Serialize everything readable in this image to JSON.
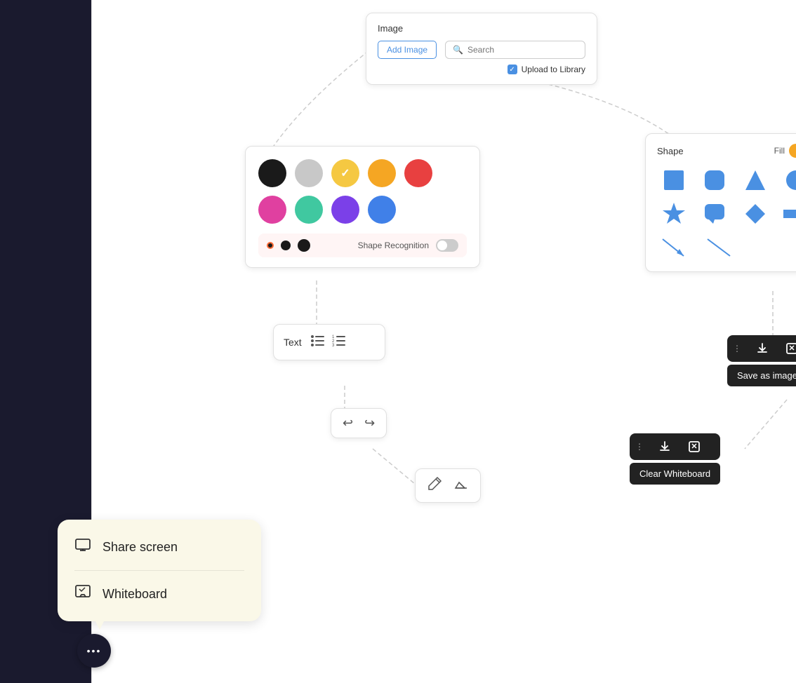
{
  "leftSidebar": {
    "background": "#1a1a2e"
  },
  "imagePanel": {
    "title": "Image",
    "addImageLabel": "Add Image",
    "searchPlaceholder": "Search",
    "uploadLabel": "Upload to Library",
    "uploadChecked": true
  },
  "colorPanel": {
    "colors": [
      {
        "name": "black",
        "hex": "#1a1a1a",
        "selected": false
      },
      {
        "name": "light-gray",
        "hex": "#c8c8c8",
        "selected": false
      },
      {
        "name": "yellow",
        "hex": "#f5c842",
        "selected": true
      },
      {
        "name": "orange",
        "hex": "#f5a623",
        "selected": false
      },
      {
        "name": "red",
        "hex": "#e84040",
        "selected": false
      },
      {
        "name": "pink",
        "hex": "#e040a0",
        "selected": false
      },
      {
        "name": "teal",
        "hex": "#40c8a0",
        "selected": false
      },
      {
        "name": "purple",
        "hex": "#7b40e8",
        "selected": false
      },
      {
        "name": "blue",
        "hex": "#4080e8",
        "selected": false
      }
    ],
    "shapeRecognitionLabel": "Shape Recognition",
    "shapeRecognitionEnabled": false,
    "penSizes": [
      "small",
      "medium",
      "large"
    ]
  },
  "shapePanel": {
    "title": "Shape",
    "fillLabel": "Fill",
    "fillEnabled": true,
    "shapes": [
      "square",
      "rounded-square",
      "triangle",
      "circle",
      "star",
      "chat-bubble",
      "diamond",
      "arrow-right",
      "diagonal-arrow",
      "diagonal-line"
    ]
  },
  "textPanel": {
    "textLabel": "Text",
    "bulletListIcon": "☰",
    "numberedListIcon": "≡"
  },
  "undoPanel": {
    "undoLabel": "↩",
    "redoLabel": "↪"
  },
  "drawPanel": {
    "penLabel": "✏",
    "eraserLabel": "⌫"
  },
  "saveToolbar": {
    "dotsLabel": "•••",
    "downloadLabel": "⬇",
    "clearLabel": "◪",
    "saveAsImageLabel": "Save as image"
  },
  "clearToolbar": {
    "dotsLabel": "•••",
    "downloadLabel": "⬇",
    "clearLabel": "◪",
    "clearWhiteboardLabel": "Clear Whiteboard"
  },
  "popupMenu": {
    "items": [
      {
        "icon": "🖥",
        "label": "Share screen"
      },
      {
        "icon": "📋",
        "label": "Whiteboard"
      }
    ]
  },
  "chatButton": {
    "dotsLabel": "•••"
  }
}
